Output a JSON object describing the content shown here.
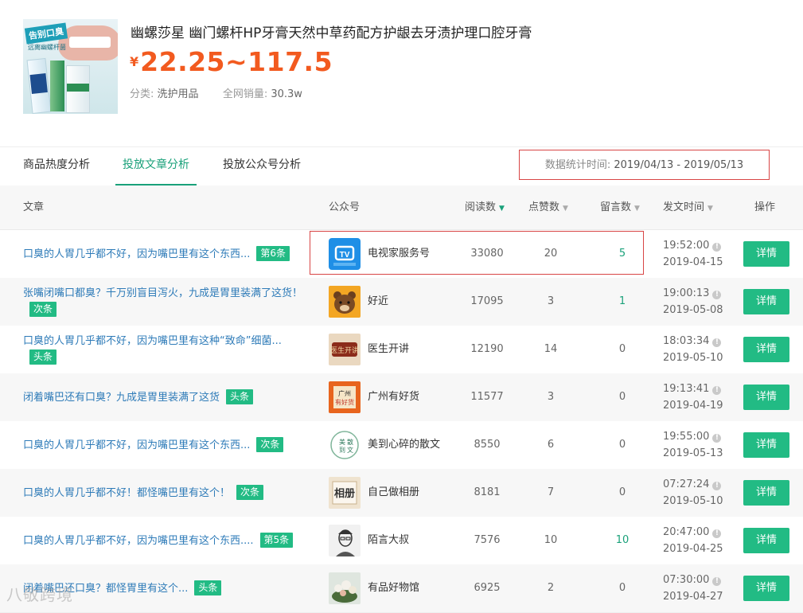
{
  "product": {
    "title": "幽螺莎星 幽门螺杆HP牙膏天然中草药配方护龈去牙渍护理口腔牙膏",
    "currency": "¥",
    "price_range": "22.25~117.5",
    "category_label": "分类:",
    "category_value": "洗护用品",
    "sales_label": "全网销量:",
    "sales_value": "30.3w",
    "image_text": "告别口臭",
    "image_subtext": "远离幽螺杆菌",
    "price_color": "#f25a1f"
  },
  "tabs": [
    {
      "label": "商品热度分析",
      "active": false
    },
    {
      "label": "投放文章分析",
      "active": true
    },
    {
      "label": "投放公众号分析",
      "active": false
    }
  ],
  "date_range": {
    "label": "数据统计时间:",
    "value": "2019/04/13 - 2019/05/13"
  },
  "table": {
    "columns": {
      "article": "文章",
      "account": "公众号",
      "reads": "阅读数",
      "likes": "点赞数",
      "comments": "留言数",
      "time": "发文时间",
      "action": "操作"
    },
    "sort_icon": "triangle-down-icon",
    "action_label": "详情",
    "rows": [
      {
        "title": "口臭的人胃几乎都不好，因为嘴巴里有这个东西...",
        "badge": "第6条",
        "account": "电视家服务号",
        "avatar": "tv-icon",
        "reads": "33080",
        "likes": "20",
        "comments": "5",
        "comments_link": true,
        "time": "19:52:00",
        "date": "2019-04-15"
      },
      {
        "title": "张嘴闭嘴口都臭？千万别盲目泻火，九成是胃里装满了这货！",
        "badge": "次条",
        "account": "好近",
        "avatar": "bear-icon",
        "reads": "17095",
        "likes": "3",
        "comments": "1",
        "comments_link": true,
        "time": "19:00:13",
        "date": "2019-05-08"
      },
      {
        "title": "口臭的人胃几乎都不好，因为嘴巴里有这种“致命”细菌...",
        "badge": "头条",
        "account": "医生开讲",
        "avatar": "doctor-icon",
        "reads": "12190",
        "likes": "14",
        "comments": "0",
        "comments_link": false,
        "time": "18:03:34",
        "date": "2019-05-10"
      },
      {
        "title": "闭着嘴巴还有口臭？九成是胃里装满了这货",
        "badge": "头条",
        "account": "广州有好货",
        "avatar": "gz-icon",
        "reads": "11577",
        "likes": "3",
        "comments": "0",
        "comments_link": false,
        "time": "19:13:41",
        "date": "2019-04-19"
      },
      {
        "title": "口臭的人胃几乎都不好，因为嘴巴里有这个东西...",
        "badge": "次条",
        "account": "美到心碎的散文",
        "avatar": "prose-icon",
        "reads": "8550",
        "likes": "6",
        "comments": "0",
        "comments_link": false,
        "time": "19:55:00",
        "date": "2019-05-13"
      },
      {
        "title": "口臭的人胃几乎都不好！都怪嘴巴里有这个！",
        "badge": "次条",
        "account": "自己做相册",
        "avatar": "album-icon",
        "reads": "8181",
        "likes": "7",
        "comments": "0",
        "comments_link": false,
        "time": "07:27:24",
        "date": "2019-05-10"
      },
      {
        "title": "口臭的人胃几乎都不好，因为嘴巴里有这个东西....",
        "badge": "第5条",
        "account": "陌言大叔",
        "avatar": "man-portrait-icon",
        "reads": "7576",
        "likes": "10",
        "comments": "10",
        "comments_link": true,
        "time": "20:47:00",
        "date": "2019-04-25"
      },
      {
        "title": "闭着嘴巴还口臭？都怪胃里有这个...",
        "badge": "头条",
        "account": "有品好物馆",
        "avatar": "flower-icon",
        "reads": "6925",
        "likes": "2",
        "comments": "0",
        "comments_link": false,
        "time": "07:30:00",
        "date": "2019-04-27"
      }
    ]
  },
  "watermark": "八敬跨境",
  "colors": {
    "accent": "#1aa17a",
    "button": "#22bb84",
    "link": "#2e7bb8",
    "highlight_box": "#d84545"
  }
}
